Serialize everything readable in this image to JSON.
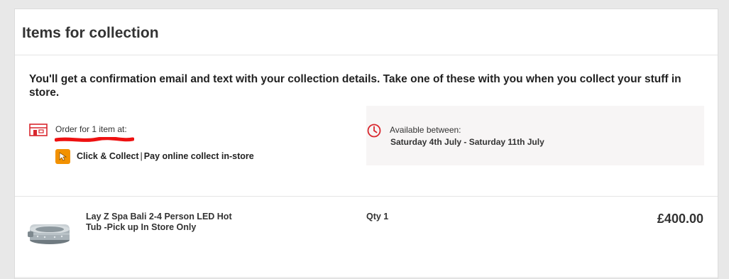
{
  "section": {
    "title": "Items for collection",
    "intro": "You'll get a confirmation email and text with your collection details. Take one of these with you when you collect your stuff in store."
  },
  "order": {
    "label": "Order for 1 item at:",
    "store_icon": "store-icon",
    "method_icon": "cursor-icon",
    "method_name": "Click & Collect",
    "method_separator": "|",
    "method_desc": "Pay online collect in-store",
    "accent_color": "#d9272e",
    "method_icon_color": "#f29100"
  },
  "availability": {
    "icon": "clock-icon",
    "label": "Available between:",
    "dates": "Saturday 4th July - Saturday 11th July"
  },
  "item": {
    "name": "Lay Z Spa Bali 2-4 Person LED Hot Tub -Pick up In Store Only",
    "qty": "Qty 1",
    "price": "£400.00",
    "image": "hot-tub-image"
  }
}
